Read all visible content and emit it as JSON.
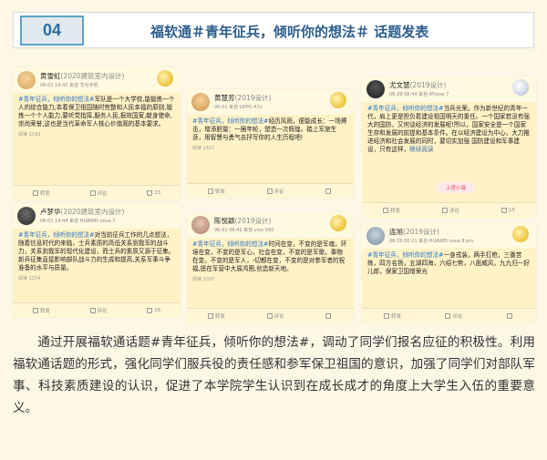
{
  "header": {
    "number": "04",
    "title": "福软通＃青年征兵，倾听你的想法＃ 话题发表"
  },
  "colors": {
    "accent_blue": "#2c5d8c",
    "badge_border": "#5da4c6",
    "hashtag_blue": "#3178c6",
    "post_bg": "#fff2c6"
  },
  "posts": [
    {
      "name": "黄雪虹",
      "tag": "(2020建筑室内设计)",
      "meta": "06-01 14:45 来自 华为手机",
      "hashtag": "#青年征兵，倾听你的想法#",
      "body": "军队是一个大学校,能锻炼一个人的综合能力,本着保卫祖国随时完整和人民幸福的原则,锻炼一个个人能力,要听党指挥,服务人民,报效国家,献身使命,崇尚荣誉,这也是当代革命军人核心价值观的基本要求。",
      "reads": "阅读 1193",
      "forward": "转发",
      "comment": "评论",
      "likes": "23",
      "avatar": "avatar-yellow"
    },
    {
      "name": "卢梦华",
      "tag": "(2020建筑室内设计)",
      "meta": "06-01 14:44 来自 HUAWEI nova 7",
      "hashtag": "#青年征兵，倾听你的想法#",
      "body": "对当前征兵工作的几点想法，随着信息时代的来临，士兵素质的高低关系到我军的战斗力，关系到我军的现代化建设，而士兵的素质又源于征集。新兵征集直接影响部队战斗力的生成和提高,关系军事斗争准备的水平与质量。",
      "reads": "阅读 1154",
      "forward": "转发",
      "comment": "评论",
      "likes": "16",
      "avatar": "avatar-dark"
    },
    {
      "name": "黄慧芳",
      "tag": "(2019设计)",
      "meta": "06-01 来自 OPPO A7x",
      "hashtag": "#青年征兵，倾听你的想法#",
      "body": "经历风雨，便能成长：一场搏击，增添胆量：一圈年轮，塑造一次辉煌。踏上军旅生涯，用智慧与勇气去抒写你的人生历程吧!",
      "reads": "阅读 1327",
      "forward": "转发",
      "comment": "评论",
      "likes": "",
      "avatar": "avatar-yellow"
    },
    {
      "name": "陈悦颖",
      "tag": "(2019设计)",
      "meta": "06-01 08:42 来自 vivo X60",
      "hashtag": "#青年征兵，倾听你的想法#",
      "body": "时间在变，不变的是军魂，环境在变，不变的是军心，社会在变，不变的是军歌，事物在变，不变的是军人，-切都在变，不变的是对参军者的祝福,愿在军营中大展鸿图,创造新天地。",
      "reads": "阅读 1037",
      "forward": "转发",
      "comment": "评论",
      "likes": "",
      "avatar": "avatar-light"
    },
    {
      "name": "尤文慧",
      "tag": "(2019设计)",
      "meta": "06-29 08:44 来自 iPhone 7",
      "hashtag": "#青年征兵，倾听你的想法#",
      "body": "当兵光荣。作为新世纪的青年一代，肩上更是担负着建设祖国明天的重任。一个国家若没有强大的国防，又何谈经济的发展呢!所以，国家安全是一个国家生存和发展的前提和基本条件。在以经济建设为中心，大力推进经济和社会发展的同时，要切实加强 国防建设和军事建设，只有这样，",
      "more": "继续阅读",
      "reads": "",
      "up_label": "上官小薇",
      "forward": "转发",
      "comment": "评论",
      "likes": "15",
      "avatar": "avatar-dark"
    },
    {
      "name": "连旭",
      "tag": "(2019设计)",
      "meta": "06-29 00:21 来自 HUAWEI nova 8 pro",
      "hashtag": "#青年征兵，倾听你的想法#",
      "body": "一身戎装，两手扛枪，三番苦练，四方名扬，五湖四海，六绍七势，八面威风，九九归一好儿郎，保家卫国增荣光",
      "reads": "",
      "forward": "转发",
      "comment": "评论",
      "likes": "",
      "avatar": "avatar-light"
    }
  ],
  "paragraph": "通过开展福软通话题#青年征兵，倾听你的想法#，调动了同学们报名应征的积极性。利用福软通话题的形式，强化同学们服兵役的责任感和参军保卫祖国的意识，加强了同学们对部队军事、科技素质建设的认识，促进了本学院学生认识到在成长成才的角度上大学生入伍的重要意义。"
}
